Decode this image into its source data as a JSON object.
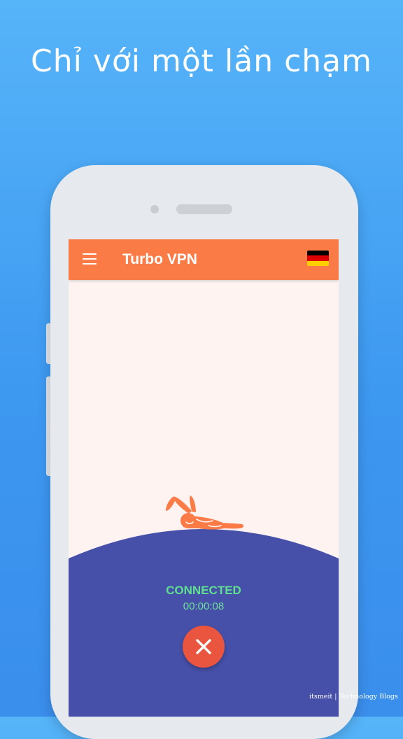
{
  "promo": {
    "headline": "Chỉ với một lần chạm"
  },
  "app": {
    "title": "Turbo VPN",
    "menu_icon": "hamburger-menu-icon",
    "server_flag": {
      "icon": "germany-flag-icon",
      "colors": [
        "#000000",
        "#dd0000",
        "#ffce00"
      ]
    }
  },
  "connection": {
    "status": "CONNECTED",
    "timer": "00:00:08",
    "disconnect_icon": "close-icon"
  },
  "colors": {
    "appbar": "#fb7b47",
    "screen_bg": "#fff3f1",
    "hill": "#4650a8",
    "status_green": "#5ee08f",
    "disconnect_red": "#e9553e",
    "rabbit": "#fb7b47"
  },
  "watermark": "itsmeit | Technology Blogs"
}
